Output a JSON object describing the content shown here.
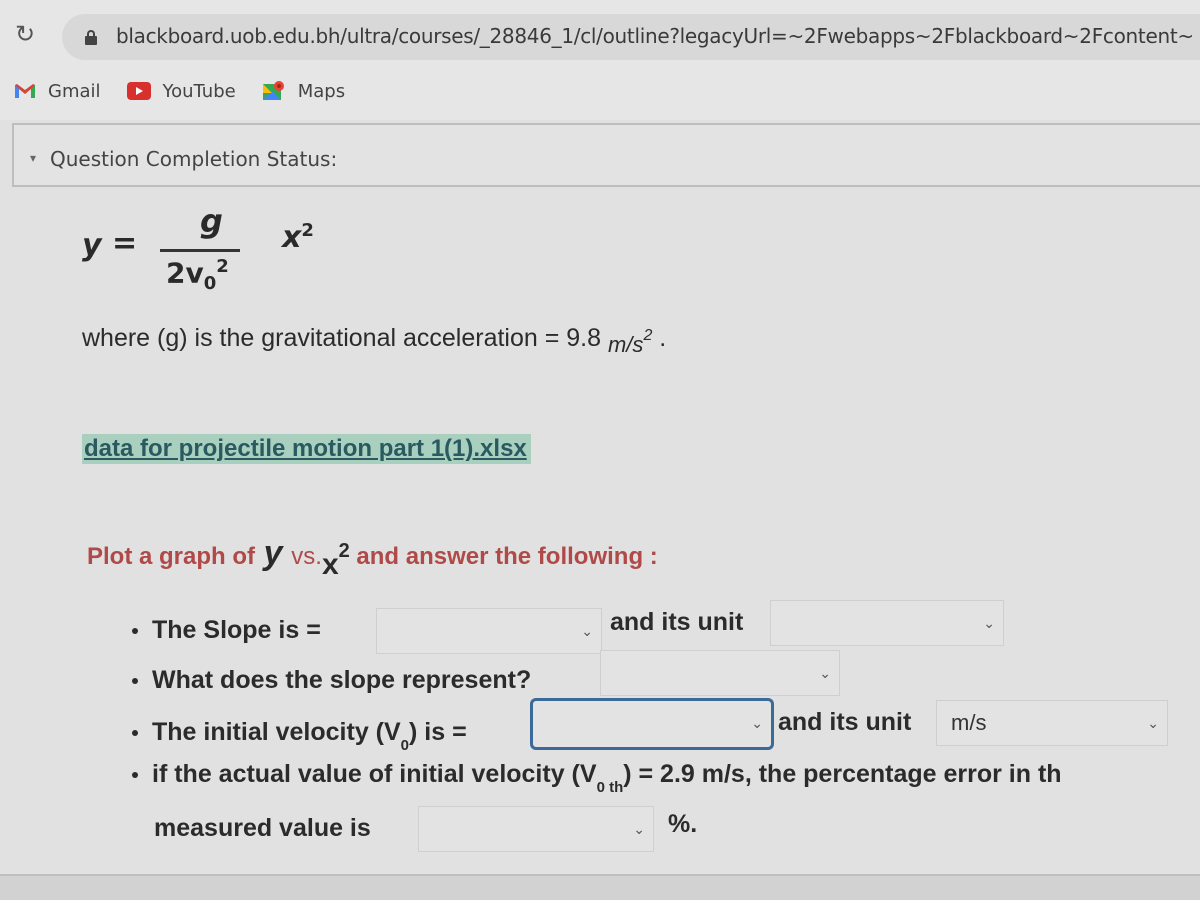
{
  "browser": {
    "url": "blackboard.uob.edu.bh/ultra/courses/_28846_1/cl/outline?legacyUrl=~2Fwebapps~2Fblackboard~2Fcontent~",
    "bookmarks": [
      {
        "label": "Gmail",
        "icon": "gmail-icon"
      },
      {
        "label": "YouTube",
        "icon": "youtube-icon"
      },
      {
        "label": "Maps",
        "icon": "maps-icon"
      }
    ]
  },
  "status": {
    "label": "Question Completion Status:",
    "icon": "double-chevron-down-icon"
  },
  "formula": {
    "lhs": "y",
    "eq": "=",
    "numerator": "g",
    "denominator_base": "2v",
    "denominator_sub": "0",
    "denominator_sup": "2",
    "x": "x",
    "x_sup": "2"
  },
  "where": {
    "text": "where (g) is the gravitational acceleration = 9.8 ",
    "unit": "m/s",
    "unit_sup": "2",
    "end": " ."
  },
  "file_link": "data for projectile motion part 1(1).xlsx",
  "plot": {
    "prefix": "Plot a graph of ",
    "y": "y",
    "vs": " vs.",
    "x": "x",
    "x_sup": "2",
    "suffix": " and answer the following :"
  },
  "questions": {
    "slope": {
      "label": "The Slope is =",
      "value": "",
      "unit_label": "and its unit",
      "unit_value": ""
    },
    "represent": {
      "label": "What does the slope represent?",
      "value": ""
    },
    "velocity": {
      "label_a": "The initial velocity (V",
      "label_sub": "0",
      "label_b": ") is =",
      "value": "",
      "unit_label": "and its unit",
      "unit_value": "m/s"
    },
    "error": {
      "label_a": "if the actual value of initial velocity (V",
      "label_sub": "0 th",
      "label_b": ") = 2.9 m/s, the percentage error in th",
      "label_c": "measured value is",
      "value": "",
      "suffix": "%."
    }
  },
  "caret": "⌄"
}
